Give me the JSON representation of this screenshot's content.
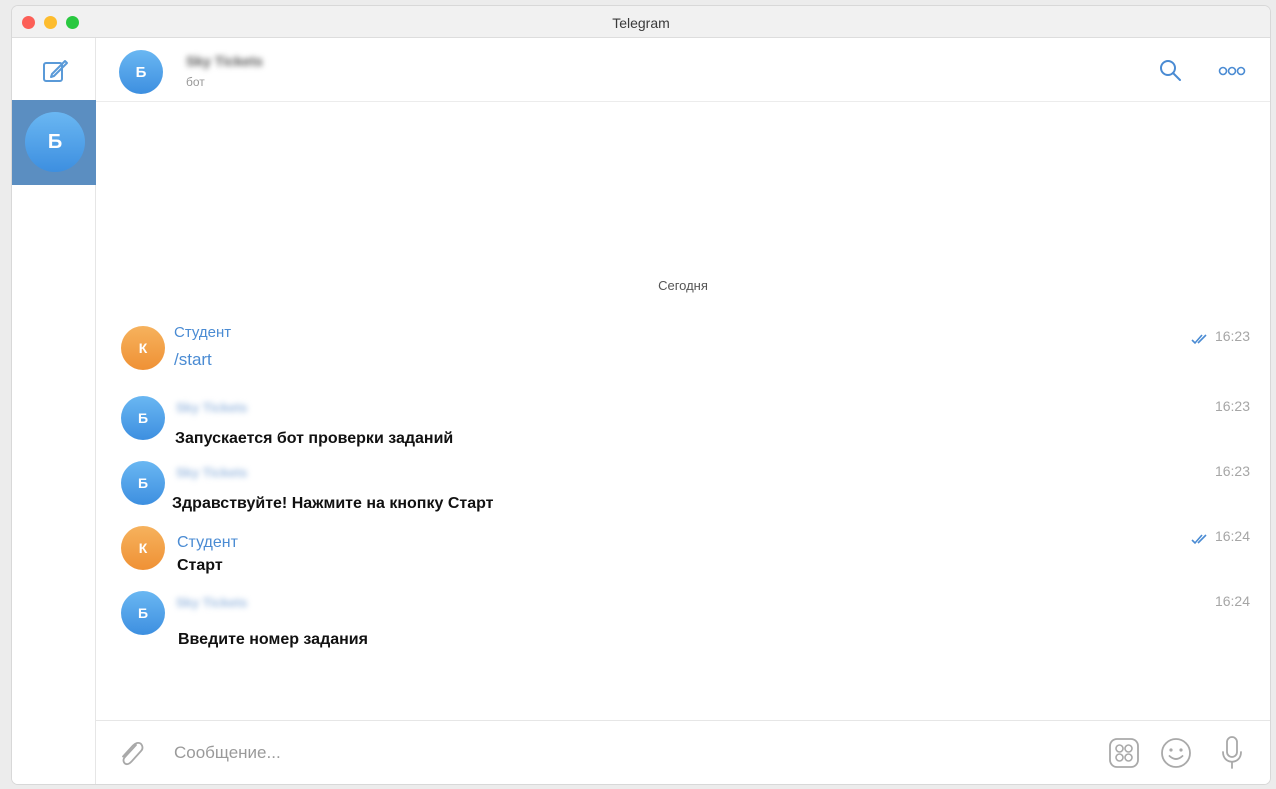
{
  "window": {
    "title": "Telegram"
  },
  "sidebar": {
    "compose_icon": "compose-icon",
    "chats": [
      {
        "avatar_letter": "Б",
        "selected": true
      }
    ]
  },
  "header": {
    "avatar_letter": "Б",
    "name": "Sky Tickets",
    "status": "бот",
    "icons": [
      "search-icon",
      "more-icon"
    ]
  },
  "chat": {
    "date_separator": "Сегодня",
    "messages": [
      {
        "avatar_letter": "К",
        "author": "Студент",
        "text": "/start",
        "time": "16:23",
        "read": true
      },
      {
        "avatar_letter": "Б",
        "author": "Sky Tickets",
        "text": "Запускается бот проверки заданий",
        "time": "16:23",
        "read": false
      },
      {
        "avatar_letter": "Б",
        "author": "Sky Tickets",
        "text": "Здравствуйте! Нажмите на кнопку Старт",
        "time": "16:23",
        "read": false
      },
      {
        "avatar_letter": "К",
        "author": "Студент",
        "text": "Старт",
        "time": "16:24",
        "read": true
      },
      {
        "avatar_letter": "Б",
        "author": "Sky Tickets",
        "text": "Введите номер задания",
        "time": "16:24",
        "read": false
      }
    ]
  },
  "composer": {
    "placeholder": "Сообщение...",
    "icons": [
      "attach-icon",
      "sticker-icon",
      "emoji-icon",
      "microphone-icon"
    ]
  },
  "colors": {
    "accent": "#4a8bd3",
    "selected_chat_bg": "#5b8ec1",
    "avatar_blue": "#3d8fe0",
    "avatar_orange": "#ef9135"
  }
}
